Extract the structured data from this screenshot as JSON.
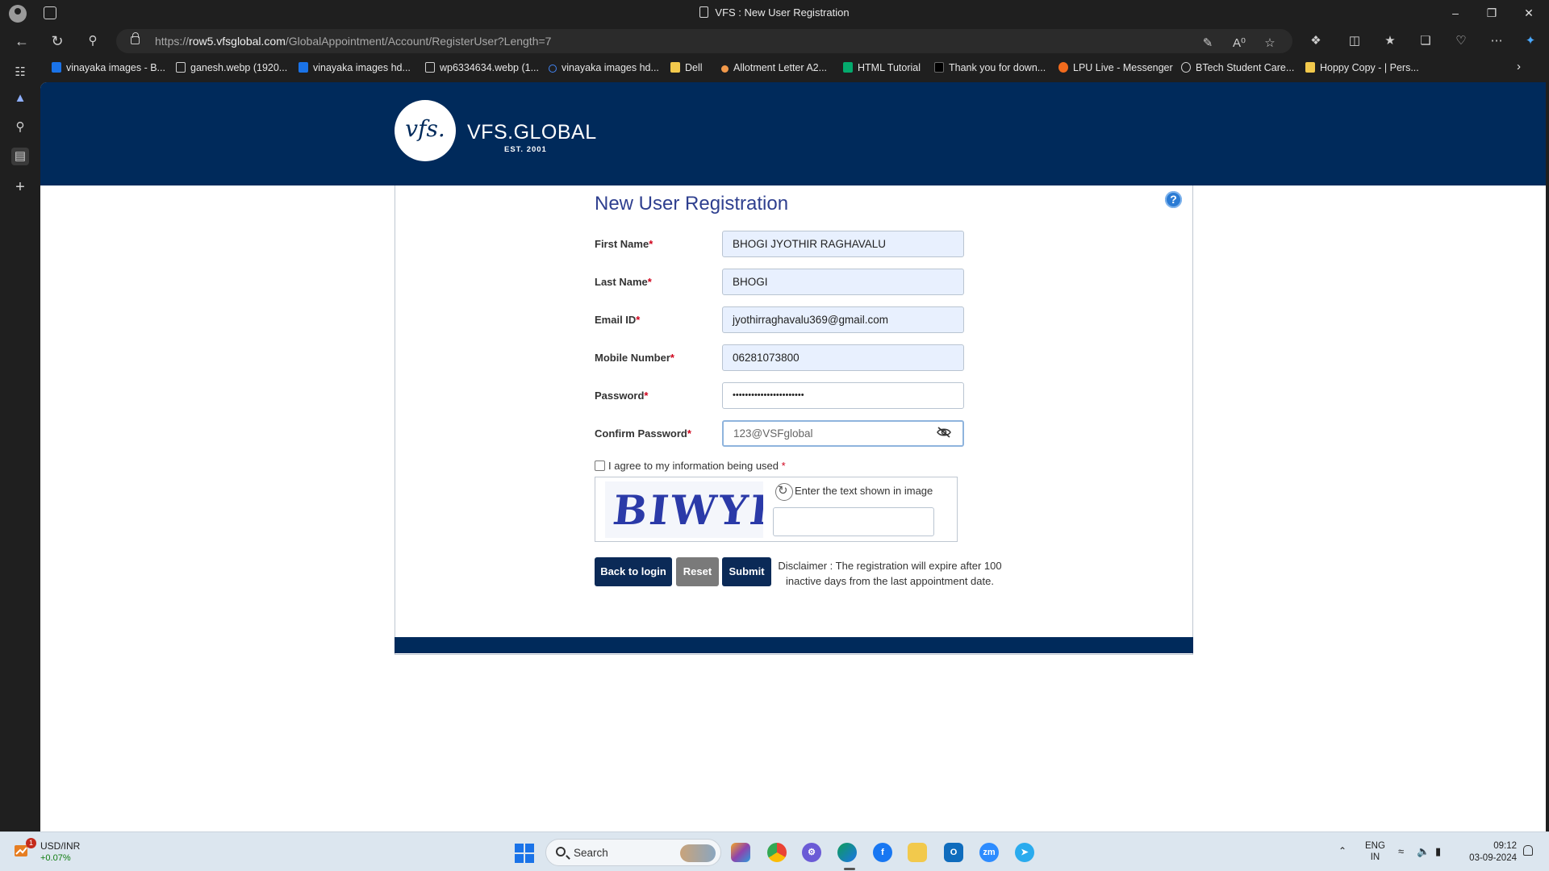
{
  "browser": {
    "tab_title": "VFS : New User Registration",
    "url_prefix": "https://",
    "url_host": "row5.vfsglobal.com",
    "url_path": "/GlobalAppointment/Account/RegisterUser?Length=7",
    "bookmarks": [
      {
        "label": "vinayaka images - B...",
        "color": "#1a73e8"
      },
      {
        "label": "ganesh.webp (1920...",
        "color": "#cfcfcf"
      },
      {
        "label": "vinayaka images hd...",
        "color": "#1a73e8"
      },
      {
        "label": "wp6334634.webp (1...",
        "color": "#cfcfcf"
      },
      {
        "label": "vinayaka images hd...",
        "color": "#4285f4"
      },
      {
        "label": "Dell",
        "color": "#f2c94c"
      },
      {
        "label": "Allotment Letter A2...",
        "color": "#f2994a"
      },
      {
        "label": "HTML Tutorial",
        "color": "#04aa6d"
      },
      {
        "label": "Thank you for down...",
        "color": "#000000"
      },
      {
        "label": "LPU Live - Messenger",
        "color": "#f26b1d"
      },
      {
        "label": "BTech Student Care...",
        "color": "#d0d0d0"
      },
      {
        "label": "Hoppy Copy - | Pers...",
        "color": "#f2c94c"
      }
    ]
  },
  "site": {
    "logo_mark": "vfs.",
    "logo_name": "VFS.GLOBAL",
    "logo_est": "EST. 2001",
    "brand_color": "#002a5b"
  },
  "form": {
    "title": "New User Registration",
    "help_label": "?",
    "fields": {
      "first_name": {
        "label": "First Name",
        "value": "BHOGI JYOTHIR RAGHAVALU"
      },
      "last_name": {
        "label": "Last Name",
        "value": "BHOGI"
      },
      "email": {
        "label": "Email ID",
        "value": "jyothirraghavalu369@gmail.com"
      },
      "mobile": {
        "label": "Mobile Number",
        "value": "06281073800"
      },
      "password": {
        "label": "Password",
        "value": "•••••••••••••••••••••••"
      },
      "confirm_password": {
        "label": "Confirm Password",
        "value": "123@VSFglobal"
      }
    },
    "required_mark": "*",
    "agree_text": "I agree to my information being used",
    "captcha": {
      "image_text": "BIWYI",
      "hint": "Enter the text shown in image",
      "value": ""
    },
    "buttons": {
      "back": "Back to login",
      "reset": "Reset",
      "submit": "Submit"
    },
    "disclaimer": "Disclaimer : The registration will expire after 100 inactive days from the last appointment date."
  },
  "taskbar": {
    "stock_name": "USD/INR",
    "stock_change": "+0.07%",
    "stock_badge": "1",
    "search_placeholder": "Search",
    "lang_line1": "ENG",
    "lang_line2": "IN",
    "time": "09:12",
    "date": "03-09-2024"
  }
}
